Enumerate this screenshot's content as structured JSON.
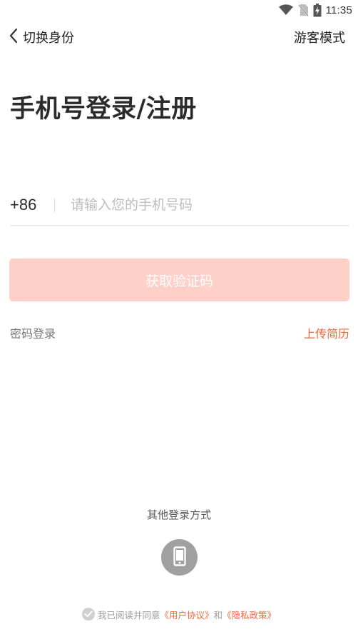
{
  "status_bar": {
    "time": "11:35",
    "icons": [
      "wifi-icon",
      "no-sim-icon",
      "battery-charging-icon"
    ]
  },
  "nav": {
    "back_icon": "chevron-left-icon",
    "back_label": "切换身份",
    "guest_label": "游客模式"
  },
  "title": "手机号登录/注册",
  "phone": {
    "country_code": "+86",
    "placeholder": "请输入您的手机号码",
    "value": ""
  },
  "get_code_label": "获取验证码",
  "links": {
    "password_login": "密码登录",
    "upload_resume": "上传简历"
  },
  "other_login": {
    "title": "其他登录方式",
    "icon": "mobile-phone-icon"
  },
  "agreement": {
    "check_icon": "check-circle-icon",
    "prefix": "我已阅读并同意",
    "user_agreement": "《用户协议》",
    "conjunction": "和",
    "privacy_policy": "《隐私政策》"
  },
  "colors": {
    "accent": "#f0663e",
    "button_disabled_bg": "#ffd0c8",
    "icon_gray": "#a0a0a0"
  }
}
